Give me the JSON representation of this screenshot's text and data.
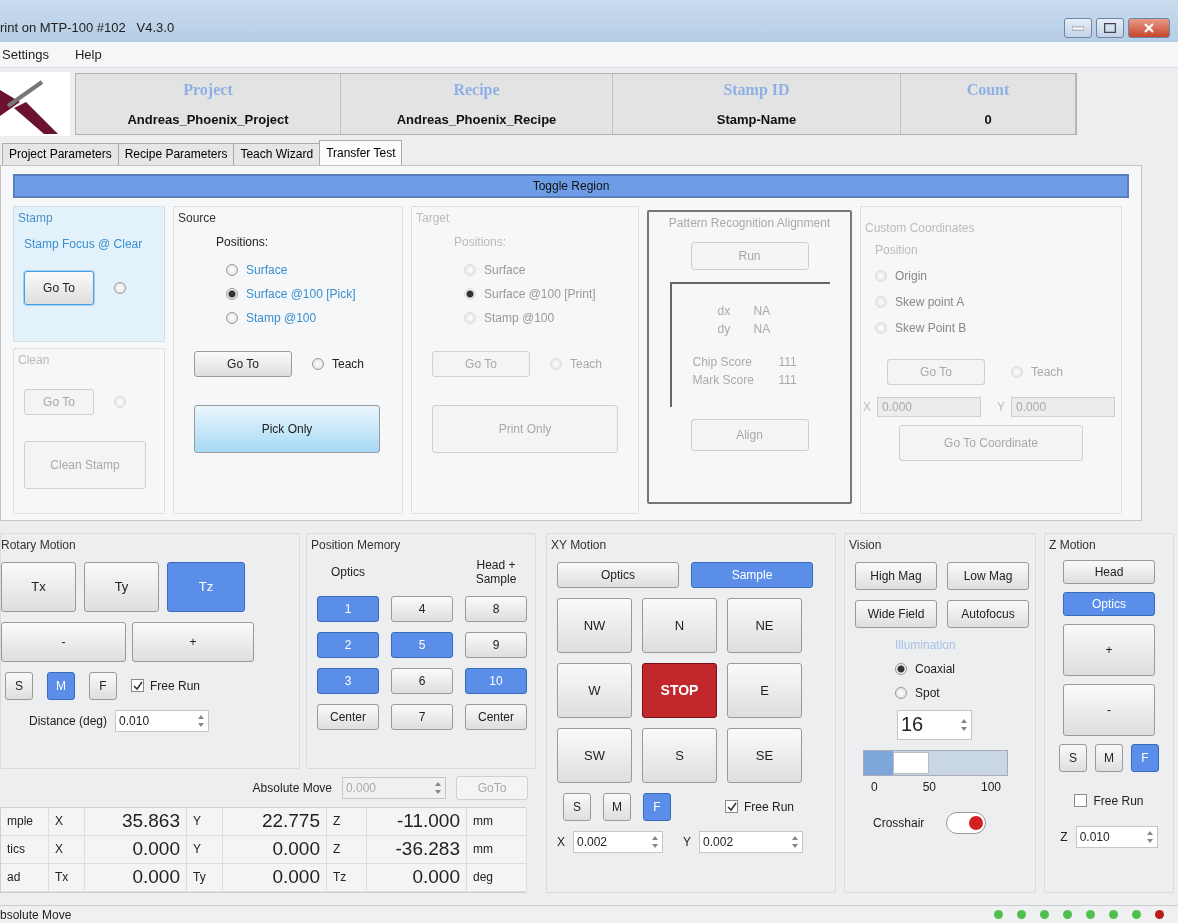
{
  "window": {
    "title": "rint on MTP-100 #102   V4.3.0"
  },
  "menu": [
    "Settings",
    "Help"
  ],
  "header": [
    {
      "label": "Project",
      "value": "Andreas_Phoenix_Project"
    },
    {
      "label": "Recipe",
      "value": "Andreas_Phoenix_Recipe"
    },
    {
      "label": "Stamp ID",
      "value": "Stamp-Name"
    },
    {
      "label": "Count",
      "value": "0"
    }
  ],
  "tabs": [
    {
      "label": "Project Parameters",
      "selected": false
    },
    {
      "label": "Recipe Parameters",
      "selected": false
    },
    {
      "label": "Teach Wizard",
      "selected": false
    },
    {
      "label": "Transfer Test",
      "selected": true
    }
  ],
  "toggle_region": "Toggle Region",
  "stamp": {
    "title": "Stamp",
    "focus_label": "Stamp Focus @ Clear",
    "goto": "Go To",
    "selected": false
  },
  "clean": {
    "title": "Clean",
    "disabled": true,
    "goto": "Go To",
    "selected": false,
    "action": "Clean Stamp"
  },
  "source": {
    "title": "Source",
    "disabled": false,
    "positions_label": "Positions:",
    "positions": [
      {
        "label": "Surface",
        "selected": false
      },
      {
        "label": "Surface @100  [Pick]",
        "selected": true
      },
      {
        "label": "Stamp @100",
        "selected": false
      }
    ],
    "goto": "Go To",
    "teach": {
      "label": "Teach",
      "selected": false
    },
    "action": "Pick Only"
  },
  "target": {
    "title": "Target",
    "disabled": true,
    "positions_label": "Positions:",
    "positions": [
      {
        "label": "Surface",
        "selected": false
      },
      {
        "label": "Surface @100  [Print]",
        "selected": true
      },
      {
        "label": "Stamp @100",
        "selected": false
      }
    ],
    "goto": "Go To",
    "teach": {
      "label": "Teach",
      "selected": false
    },
    "action": "Print Only"
  },
  "pattern": {
    "title": "Pattern Recognition Alignment",
    "run": "Run",
    "offsets": [
      {
        "label": "dx",
        "value": "NA"
      },
      {
        "label": "dy",
        "value": "NA"
      }
    ],
    "scores": [
      {
        "label": "Chip Score",
        "value": "111"
      },
      {
        "label": "Mark Score",
        "value": "111"
      }
    ],
    "align": "Align"
  },
  "custom": {
    "title": "Custom Coordinates",
    "position_label": "Position",
    "positions": [
      {
        "label": "Origin",
        "selected": false
      },
      {
        "label": "Skew point A",
        "selected": false
      },
      {
        "label": "Skew Point B",
        "selected": false
      }
    ],
    "goto": "Go To",
    "teach": {
      "label": "Teach",
      "selected": false
    },
    "x": {
      "label": "X",
      "value": "0.000"
    },
    "y": {
      "label": "Y",
      "value": "0.000"
    },
    "go_coordinate": "Go To Coordinate"
  },
  "rotary": {
    "title": "Rotary Motion",
    "axes": [
      {
        "label": "Tx",
        "selected": false
      },
      {
        "label": "Ty",
        "selected": false
      },
      {
        "label": "Tz",
        "selected": true
      }
    ],
    "minus": "-",
    "plus": "+",
    "speeds": [
      {
        "label": "S",
        "selected": false
      },
      {
        "label": "M",
        "selected": true
      },
      {
        "label": "F",
        "selected": false
      }
    ],
    "free_run": {
      "label": "Free Run",
      "checked": true
    },
    "distance": {
      "label": "Distance (deg)",
      "value": "0.010"
    }
  },
  "position_memory": {
    "title": "Position Memory",
    "column_labels": [
      "Optics",
      "Head + Sample"
    ],
    "buttons": [
      {
        "label": "1",
        "selected": true
      },
      {
        "label": "4",
        "selected": false
      },
      {
        "label": "8",
        "selected": false
      },
      {
        "label": "2",
        "selected": true
      },
      {
        "label": "5",
        "selected": true
      },
      {
        "label": "9",
        "selected": false
      },
      {
        "label": "3",
        "selected": true
      },
      {
        "label": "6",
        "selected": false
      },
      {
        "label": "10",
        "selected": true
      },
      {
        "label": "Center",
        "selected": false
      },
      {
        "label": "7",
        "selected": false
      },
      {
        "label": "Center",
        "selected": false
      }
    ]
  },
  "absolute_move": {
    "label": "Absolute Move",
    "value": "0.000",
    "disabled": true,
    "button": "GoTo"
  },
  "readout": [
    {
      "name": "mple",
      "cells": [
        "X",
        "35.863",
        "Y",
        "22.775",
        "Z",
        "-11.000",
        "mm"
      ]
    },
    {
      "name": "tics",
      "cells": [
        "X",
        "0.000",
        "Y",
        "0.000",
        "Z",
        "-36.283",
        "mm"
      ]
    },
    {
      "name": "ad",
      "cells": [
        "Tx",
        "0.000",
        "Ty",
        "0.000",
        "Tz",
        "0.000",
        "deg"
      ]
    }
  ],
  "xy_motion": {
    "title": "XY Motion",
    "modes": [
      {
        "label": "Optics",
        "selected": false
      },
      {
        "label": "Sample",
        "selected": true
      }
    ],
    "directions": [
      {
        "label": "NW",
        "kind": "move"
      },
      {
        "label": "N",
        "kind": "move"
      },
      {
        "label": "NE",
        "kind": "move"
      },
      {
        "label": "W",
        "kind": "move"
      },
      {
        "label": "STOP",
        "kind": "stop"
      },
      {
        "label": "E",
        "kind": "move"
      },
      {
        "label": "SW",
        "kind": "move"
      },
      {
        "label": "S",
        "kind": "move"
      },
      {
        "label": "SE",
        "kind": "move"
      }
    ],
    "speeds": [
      {
        "label": "S",
        "selected": false
      },
      {
        "label": "M",
        "selected": false
      },
      {
        "label": "F",
        "selected": true
      }
    ],
    "free_run": {
      "label": "Free Run",
      "checked": true
    },
    "x": {
      "label": "X",
      "value": "0.002"
    },
    "y": {
      "label": "Y",
      "value": "0.002"
    }
  },
  "vision": {
    "title": "Vision",
    "buttons": [
      "High Mag",
      "Low Mag",
      "Wide Field",
      "Autofocus"
    ],
    "illumination_label": "Illumination",
    "illumination": [
      {
        "label": "Coaxial",
        "selected": true
      },
      {
        "label": "Spot",
        "selected": false
      }
    ],
    "intensity": "16",
    "slider": {
      "level": 0.2,
      "ticks": [
        "0",
        "50",
        "100"
      ]
    },
    "crosshair": {
      "label": "Crosshair",
      "on": true
    }
  },
  "z_motion": {
    "title": "Z Motion",
    "modes": [
      {
        "label": "Head",
        "selected": false
      },
      {
        "label": "Optics",
        "selected": true
      }
    ],
    "plus": "+",
    "minus": "-",
    "speeds": [
      {
        "label": "S",
        "selected": false
      },
      {
        "label": "M",
        "selected": false
      },
      {
        "label": "F",
        "selected": true
      }
    ],
    "free_run": {
      "label": "Free Run",
      "checked": false
    },
    "z": {
      "label": "Z",
      "value": "0.010"
    }
  },
  "status_bar": {
    "text": "bsolute Move",
    "indicators": [
      {
        "color": "#4fc04f"
      },
      {
        "color": "#4fc04f"
      },
      {
        "color": "#4fc04f"
      },
      {
        "color": "#4fc04f"
      },
      {
        "color": "#4fc04f"
      },
      {
        "color": "#4fc04f"
      },
      {
        "color": "#4fc04f"
      },
      {
        "color": "#b81c1c"
      }
    ]
  }
}
